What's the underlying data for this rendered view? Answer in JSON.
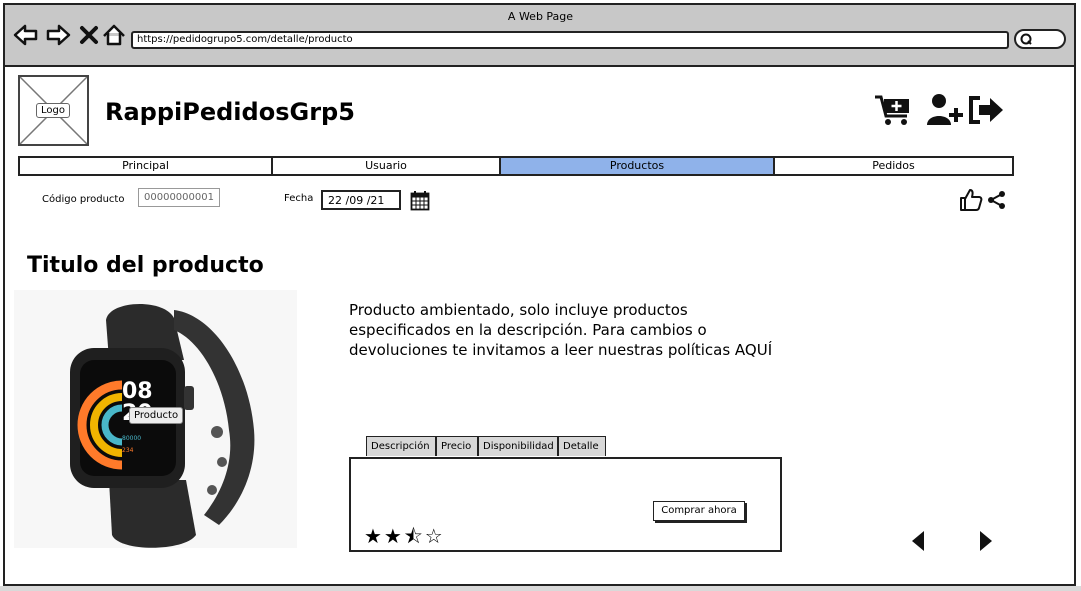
{
  "browser": {
    "window_title": "A Web Page",
    "url": "https://pedidogrupo5.com/detalle/producto",
    "nav_icons": [
      "back-arrow-icon",
      "forward-arrow-icon",
      "close-icon",
      "home-icon"
    ],
    "search_icon": "search-icon"
  },
  "header": {
    "logo_label": "Logo",
    "brand": "RappiPedidosGrp5",
    "icons": [
      "cart-add-icon",
      "add-user-icon",
      "sign-out-icon"
    ]
  },
  "nav": {
    "tabs": [
      {
        "label": "Principal",
        "active": false
      },
      {
        "label": "Usuario",
        "active": false
      },
      {
        "label": "Productos",
        "active": true
      },
      {
        "label": "Pedidos",
        "active": false
      }
    ],
    "active_color": "#8fb2ea"
  },
  "filters": {
    "code_label": "Código producto",
    "code_value": "00000000001",
    "date_label": "Fecha",
    "date_value": "22 /09 /21",
    "calendar_icon": "calendar-icon",
    "like_icon": "thumbs-up-icon",
    "share_icon": "share-icon"
  },
  "product": {
    "title": "Titulo del producto",
    "image_label": "Producto",
    "description": "Producto ambientado, solo incluye productos especificados en la descripción. Para cambios o devoluciones te invitamos a leer nuestras políticas AQUÍ",
    "tabs": [
      "Descripción",
      "Precio",
      "Disponibilidad",
      "Detalle"
    ],
    "buy_label": "Comprar ahora",
    "rating": 2.5,
    "rating_max": 4,
    "stars_text": "★★⯪☆"
  },
  "pager": {
    "prev_icon": "caret-left-icon",
    "next_icon": "caret-right-icon"
  }
}
